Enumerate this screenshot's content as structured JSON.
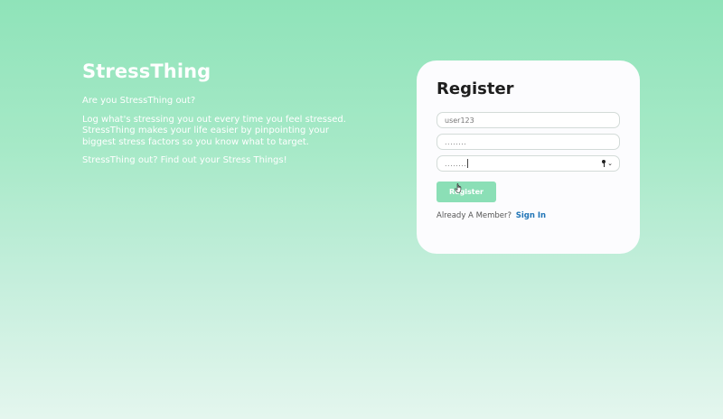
{
  "hero": {
    "brand": "StressThing",
    "tagline": "Are you StressThing out?",
    "description": "Log what's stressing you out every time you feel stressed. StressThing makes your life easier by pinpointing your biggest stress factors so you know what to target.",
    "cta_text": "StressThing out? Find out your Stress Things!"
  },
  "register": {
    "title": "Register",
    "username_value": "user123",
    "password_value": "........",
    "confirm_password_value": "........",
    "submit_label": "Register",
    "member_prompt": "Already A Member?",
    "signin_label": "Sign In"
  },
  "icons": {
    "password_toggle": "key-icon",
    "password_dropdown": "chevron-down-icon",
    "pointer": "hand-pointer-icon"
  },
  "colors": {
    "accent": "#8bdfb6",
    "link": "#1f74b6",
    "background_top": "#8fe3b9",
    "background_bottom": "#e4f6ee"
  }
}
